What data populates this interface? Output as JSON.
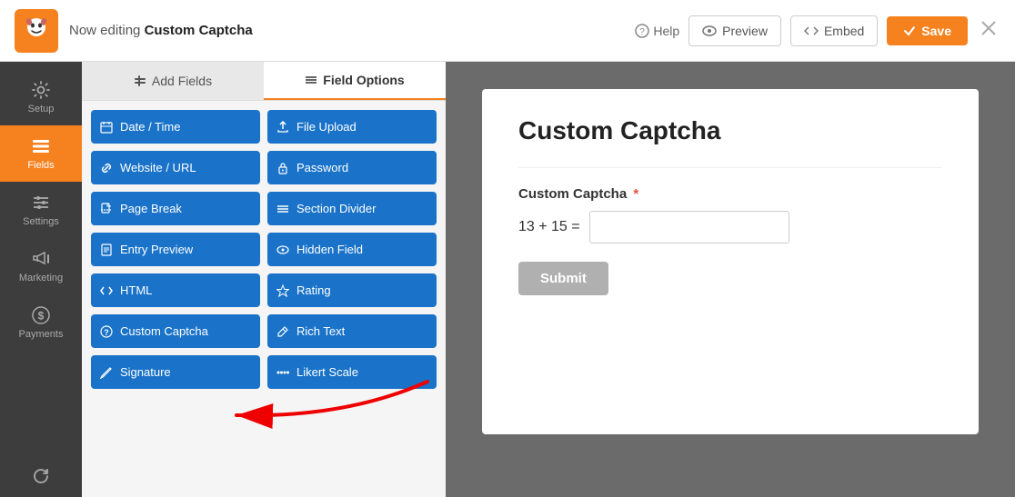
{
  "topbar": {
    "editing_prefix": "Now editing",
    "form_name": "Custom Captcha",
    "help_label": "Help",
    "preview_label": "Preview",
    "embed_label": "Embed",
    "save_label": "Save"
  },
  "sidebar": {
    "items": [
      {
        "id": "setup",
        "label": "Setup",
        "icon": "gear"
      },
      {
        "id": "fields",
        "label": "Fields",
        "icon": "fields",
        "active": true
      },
      {
        "id": "settings",
        "label": "Settings",
        "icon": "sliders"
      },
      {
        "id": "marketing",
        "label": "Marketing",
        "icon": "megaphone"
      },
      {
        "id": "payments",
        "label": "Payments",
        "icon": "dollar"
      },
      {
        "id": "revisions",
        "label": "",
        "icon": "refresh"
      }
    ]
  },
  "panel": {
    "tabs": [
      {
        "id": "add-fields",
        "label": "Add Fields",
        "active": false
      },
      {
        "id": "field-options",
        "label": "Field Options",
        "active": true
      }
    ],
    "fields": [
      {
        "id": "date-time",
        "label": "Date / Time",
        "icon": "calendar"
      },
      {
        "id": "file-upload",
        "label": "File Upload",
        "icon": "upload"
      },
      {
        "id": "website-url",
        "label": "Website / URL",
        "icon": "link"
      },
      {
        "id": "password",
        "label": "Password",
        "icon": "lock"
      },
      {
        "id": "page-break",
        "label": "Page Break",
        "icon": "page"
      },
      {
        "id": "section-divider",
        "label": "Section Divider",
        "icon": "divider"
      },
      {
        "id": "entry-preview",
        "label": "Entry Preview",
        "icon": "doc"
      },
      {
        "id": "hidden-field",
        "label": "Hidden Field",
        "icon": "eye"
      },
      {
        "id": "html",
        "label": "HTML",
        "icon": "code"
      },
      {
        "id": "rating",
        "label": "Rating",
        "icon": "star"
      },
      {
        "id": "custom-captcha",
        "label": "Custom Captcha",
        "icon": "question"
      },
      {
        "id": "rich-text",
        "label": "Rich Text",
        "icon": "edit"
      },
      {
        "id": "signature",
        "label": "Signature",
        "icon": "pen"
      },
      {
        "id": "likert-scale",
        "label": "Likert Scale",
        "icon": "dots"
      }
    ]
  },
  "form_preview": {
    "title": "Custom Captcha",
    "field_label": "Custom Captcha",
    "required": true,
    "captcha_expression": "13 + 15 =",
    "submit_label": "Submit"
  }
}
